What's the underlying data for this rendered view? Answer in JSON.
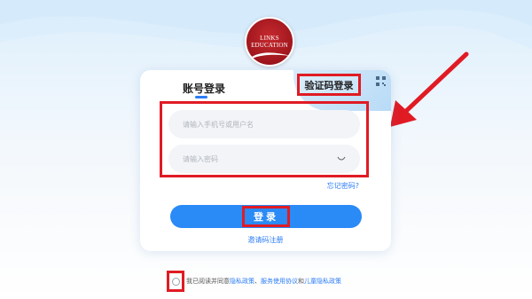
{
  "logo": {
    "line1": "LINKS",
    "line2": "EDUCATION"
  },
  "tabs": {
    "account": "账号登录",
    "sms": "验证码登录"
  },
  "form": {
    "username_placeholder": "请输入手机号或用户名",
    "password_placeholder": "请输入密码",
    "forgot": "忘记密码?",
    "login": "登录",
    "invite": "邀请码注册"
  },
  "agreement": {
    "prefix": "我已阅读并同意",
    "privacy": "隐私政策",
    "sep": "、",
    "service": "服务使用协议",
    "and": "和",
    "child": "儿童隐私政策"
  },
  "colors": {
    "accent": "#2a8af6",
    "highlight": "#e01b24",
    "brand": "#9c141b"
  }
}
